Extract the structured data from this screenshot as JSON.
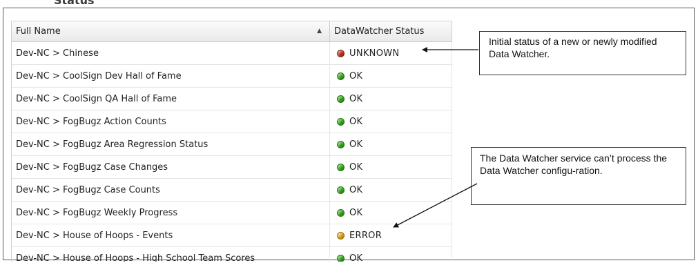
{
  "section_title": "Status",
  "grid": {
    "columns": [
      {
        "label": "Full Name",
        "sort": "ascending"
      },
      {
        "label": "DataWatcher Status"
      }
    ],
    "rows": [
      {
        "name": "Dev-NC > Chinese",
        "status": "UNKNOWN",
        "status_color": "#c8361f"
      },
      {
        "name": "Dev-NC > CoolSign Dev Hall of Fame",
        "status": "OK",
        "status_color": "#37b51e"
      },
      {
        "name": "Dev-NC > CoolSign QA Hall of Fame",
        "status": "OK",
        "status_color": "#37b51e"
      },
      {
        "name": "Dev-NC > FogBugz Action Counts",
        "status": "OK",
        "status_color": "#37b51e"
      },
      {
        "name": "Dev-NC > FogBugz Area Regression Status",
        "status": "OK",
        "status_color": "#37b51e"
      },
      {
        "name": "Dev-NC > FogBugz Case Changes",
        "status": "OK",
        "status_color": "#37b51e"
      },
      {
        "name": "Dev-NC > FogBugz Case Counts",
        "status": "OK",
        "status_color": "#37b51e"
      },
      {
        "name": "Dev-NC > FogBugz Weekly Progress",
        "status": "OK",
        "status_color": "#37b51e"
      },
      {
        "name": "Dev-NC > House of Hoops - Events",
        "status": "ERROR",
        "status_color": "#f0b51a"
      },
      {
        "name": "Dev-NC > House of Hoops - High School Team Scores",
        "status": "OK",
        "status_color": "#37b51e"
      }
    ]
  },
  "callouts": [
    {
      "text": "Initial status of a new or newly modified Data Watcher."
    },
    {
      "text": "The Data Watcher service can’t process the Data Watcher configu-ration."
    }
  ]
}
